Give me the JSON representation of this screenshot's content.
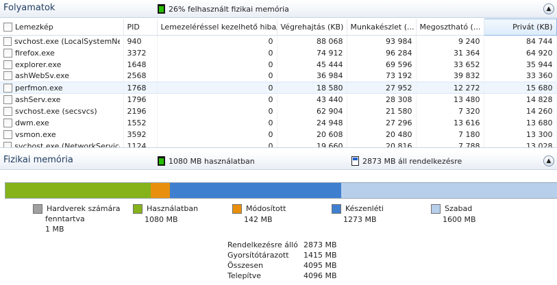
{
  "processes_section": {
    "title": "Folyamatok",
    "stat": "26% felhasznált fizikai memória",
    "columns": [
      "Lemezkép",
      "PID",
      "Lemezeléréssel kezelhető hiba/s",
      "Végrehajtás (KB)",
      "Munkakészlet (...",
      "Megosztható (...",
      "Privát (KB)"
    ],
    "rows": [
      {
        "name": "svchost.exe (LocalSystemNet...",
        "pid": "940",
        "faults": "0",
        "commit": "88 068",
        "working_set": "93 984",
        "shareable": "9 240",
        "private": "84 744"
      },
      {
        "name": "firefox.exe",
        "pid": "3372",
        "faults": "0",
        "commit": "74 912",
        "working_set": "96 284",
        "shareable": "31 364",
        "private": "64 920"
      },
      {
        "name": "explorer.exe",
        "pid": "1648",
        "faults": "0",
        "commit": "45 444",
        "working_set": "69 596",
        "shareable": "33 652",
        "private": "35 944"
      },
      {
        "name": "ashWebSv.exe",
        "pid": "2568",
        "faults": "0",
        "commit": "36 984",
        "working_set": "73 192",
        "shareable": "39 832",
        "private": "33 360"
      },
      {
        "name": "perfmon.exe",
        "pid": "1768",
        "faults": "0",
        "commit": "18 580",
        "working_set": "27 952",
        "shareable": "12 272",
        "private": "15 680"
      },
      {
        "name": "ashServ.exe",
        "pid": "1796",
        "faults": "0",
        "commit": "43 440",
        "working_set": "28 308",
        "shareable": "13 480",
        "private": "14 828"
      },
      {
        "name": "svchost.exe (secsvcs)",
        "pid": "2196",
        "faults": "0",
        "commit": "62 904",
        "working_set": "21 580",
        "shareable": "7 320",
        "private": "14 260"
      },
      {
        "name": "dwm.exe",
        "pid": "1552",
        "faults": "0",
        "commit": "24 948",
        "working_set": "27 296",
        "shareable": "13 616",
        "private": "13 680"
      },
      {
        "name": "vsmon.exe",
        "pid": "3592",
        "faults": "0",
        "commit": "20 608",
        "working_set": "20 480",
        "shareable": "7 180",
        "private": "13 300"
      },
      {
        "name": "svchost.exe (NetworkService)",
        "pid": "1124",
        "faults": "0",
        "commit": "19 660",
        "working_set": "20 816",
        "shareable": "7 788",
        "private": "13 028"
      }
    ],
    "selected_row": 4,
    "sorted_column": "Privát (KB)"
  },
  "memory_section": {
    "title": "Fizikai memória",
    "stat_in_use": "1080 MB használatban",
    "stat_available": "2873 MB áll rendelkezésre",
    "bar": [
      {
        "key": "in_use",
        "mb": 1080,
        "color": "#86b21a"
      },
      {
        "key": "modified",
        "mb": 142,
        "color": "#e8900e"
      },
      {
        "key": "standby",
        "mb": 1273,
        "color": "#3f7fd0"
      },
      {
        "key": "free",
        "mb": 1600,
        "color": "#b8cfec"
      }
    ],
    "legend": {
      "reserved": {
        "label_line1": "Hardverek számára",
        "label_line2": "fenntartva",
        "value": "1 MB",
        "color": "#a0a0a0"
      },
      "in_use": {
        "label": "Használatban",
        "value": "1080 MB",
        "color": "#86b21a"
      },
      "modified": {
        "label": "Módosított",
        "value": "142 MB",
        "color": "#e8900e"
      },
      "standby": {
        "label": "Készenléti",
        "value": "1273 MB",
        "color": "#3f7fd0"
      },
      "free": {
        "label": "Szabad",
        "value": "1600 MB",
        "color": "#b8cfec"
      }
    },
    "summary": [
      {
        "label": "Rendelkezésre álló",
        "value": "2873 MB"
      },
      {
        "label": "Gyorsítótárazott",
        "value": "1415 MB"
      },
      {
        "label": "Összesen",
        "value": "4095 MB"
      },
      {
        "label": "Telepítve",
        "value": "4096 MB"
      }
    ]
  },
  "colors": {
    "header_text": "#1e3a5f",
    "selection": "#eef5fc"
  }
}
